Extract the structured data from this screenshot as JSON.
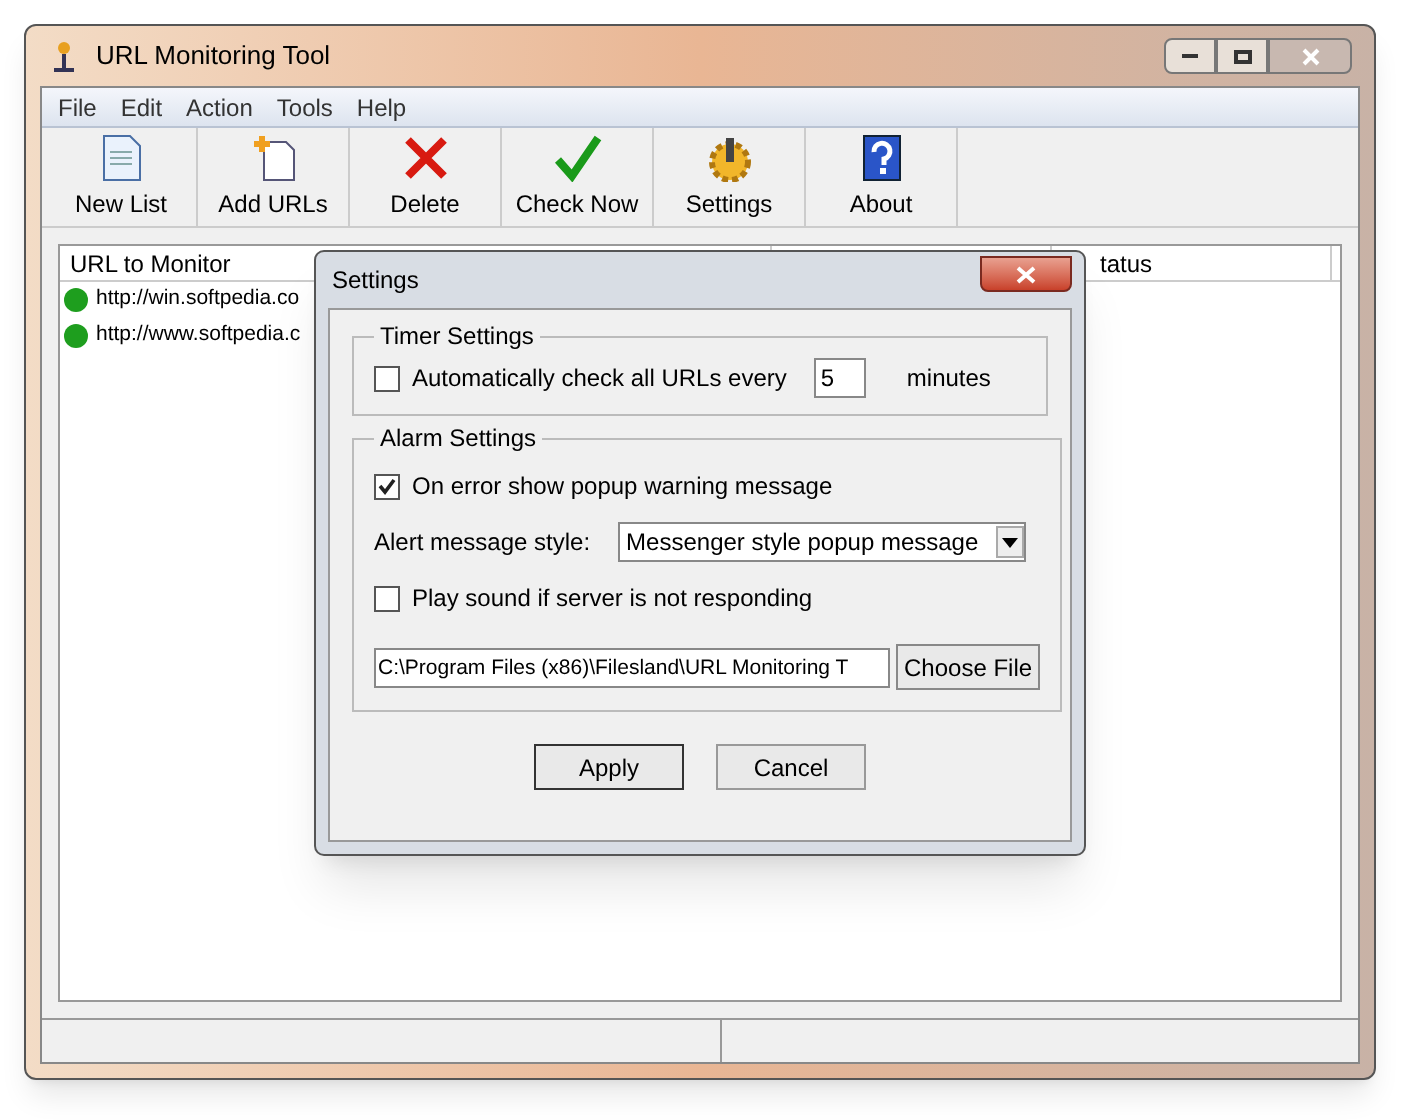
{
  "window": {
    "title": "URL Monitoring Tool"
  },
  "menu": [
    "File",
    "Edit",
    "Action",
    "Tools",
    "Help"
  ],
  "toolbar": [
    {
      "label": "New List",
      "kind": "new"
    },
    {
      "label": "Add URLs",
      "kind": "add"
    },
    {
      "label": "Delete",
      "kind": "delete"
    },
    {
      "label": "Check Now",
      "kind": "check"
    },
    {
      "label": "Settings",
      "kind": "settings"
    },
    {
      "label": "About",
      "kind": "about"
    }
  ],
  "table": {
    "columns": [
      "URL to Monitor",
      "",
      "tatus"
    ],
    "rows": [
      {
        "url": "http://win.softpedia.co",
        "color": "#1e9e1e"
      },
      {
        "url": "http://www.softpedia.c",
        "color": "#1e9e1e"
      }
    ]
  },
  "dialog": {
    "title": "Settings",
    "timer": {
      "legend": "Timer Settings",
      "label": "Automatically check all URLs every",
      "checked": false,
      "value": "5",
      "unit": "minutes"
    },
    "alarm": {
      "legend": "Alarm Settings",
      "popup_label": "On error show popup warning message",
      "popup_checked": true,
      "style_label": "Alert message style:",
      "style_value": "Messenger style popup message",
      "sound_label": "Play sound if server is not responding",
      "sound_checked": false,
      "path": "C:\\Program Files (x86)\\Filesland\\URL Monitoring T",
      "choose": "Choose File"
    },
    "buttons": [
      "Apply",
      "Cancel"
    ]
  }
}
